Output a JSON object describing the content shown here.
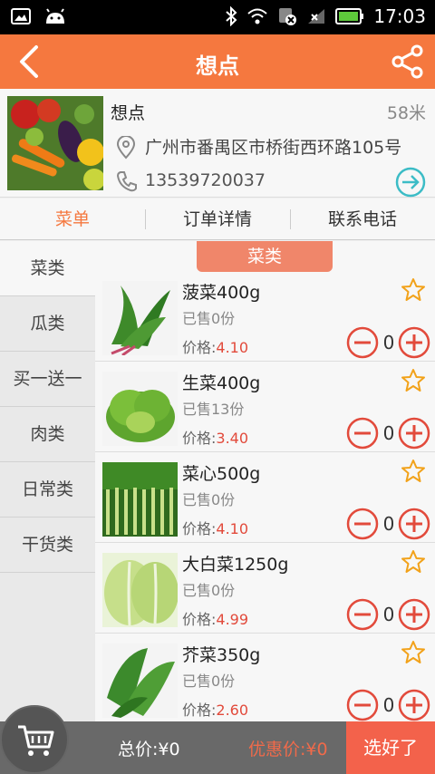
{
  "statusbar": {
    "time": "17:03"
  },
  "header": {
    "title": "想点"
  },
  "shop": {
    "name": "想点",
    "distance": "58米",
    "address": "广州市番禺区市桥街西环路105号",
    "phone": "13539720037"
  },
  "tabs": [
    {
      "label": "菜单",
      "active": true
    },
    {
      "label": "订单详情",
      "active": false
    },
    {
      "label": "联系电话",
      "active": false
    }
  ],
  "categories": [
    "菜类",
    "瓜类",
    "买一送一",
    "肉类",
    "日常类",
    "干货类"
  ],
  "section": {
    "title": "菜类"
  },
  "products": [
    {
      "name": "菠菜400g",
      "sold": "已售0份",
      "price_label": "价格:",
      "price": "4.10",
      "qty": "0"
    },
    {
      "name": "生菜400g",
      "sold": "已售13份",
      "price_label": "价格:",
      "price": "3.40",
      "qty": "0"
    },
    {
      "name": "菜心500g",
      "sold": "已售0份",
      "price_label": "价格:",
      "price": "4.10",
      "qty": "0"
    },
    {
      "name": "大白菜1250g",
      "sold": "已售0份",
      "price_label": "价格:",
      "price": "4.99",
      "qty": "0"
    },
    {
      "name": "芥菜350g",
      "sold": "已售0份",
      "price_label": "价格:",
      "price": "2.60",
      "qty": "0"
    }
  ],
  "footer": {
    "total": "总价:¥0",
    "discount": "优惠价:¥0",
    "confirm": "选好了"
  },
  "colors": {
    "accent": "#f5783f",
    "price": "#e24a3b",
    "footer": "#696969",
    "confirm": "#f3624b"
  }
}
